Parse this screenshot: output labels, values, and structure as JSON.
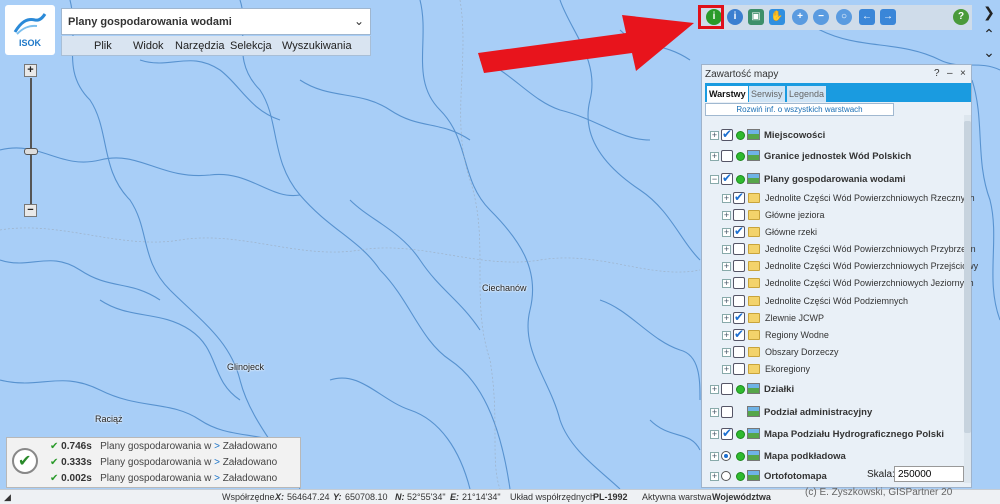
{
  "app": {
    "logo_text": "ISOK",
    "title": "Plany gospodarowania wodami"
  },
  "menu": [
    "Plik",
    "Widok",
    "Narzędzia",
    "Selekcja",
    "Wyszukiwania"
  ],
  "map": {
    "towns": [
      "Ciechanów",
      "Glinojeck",
      "Raciąż"
    ]
  },
  "toolbar": {
    "icons": [
      "info-green-icon",
      "info-blue-icon",
      "select-area-icon",
      "pan-hand-icon",
      "zoom-in-icon",
      "zoom-out-icon",
      "zoom-extent-icon",
      "history-back-icon",
      "history-forward-icon",
      "help-icon"
    ]
  },
  "panel": {
    "title": "Zawartość mapy",
    "tabs": [
      "Warstwy",
      "Serwisy",
      "Legenda"
    ],
    "expand_all": "Rozwiń inf. o wszystkich warstwach",
    "layers": [
      {
        "label": "Miejscowości",
        "level": 0,
        "checked": true,
        "dot": true,
        "icon": "image"
      },
      {
        "label": "Granice jednostek Wód Polskich",
        "level": 0,
        "checked": false,
        "dot": true,
        "icon": "image"
      },
      {
        "label": "Plany gospodarowania wodami",
        "level": 0,
        "checked": true,
        "dot": true,
        "icon": "image",
        "expanded": true
      },
      {
        "label": "Jednolite Części Wód Powierzchniowych Rzecznych",
        "level": 1,
        "checked": true,
        "icon": "folder"
      },
      {
        "label": "Główne jeziora",
        "level": 1,
        "checked": false,
        "icon": "folder"
      },
      {
        "label": "Główne rzeki",
        "level": 1,
        "checked": true,
        "icon": "folder"
      },
      {
        "label": "Jednolite Części Wód Powierzchniowych Przybrzeżn",
        "level": 1,
        "checked": false,
        "icon": "folder"
      },
      {
        "label": "Jednolite Części Wód Powierzchniowych Przejściowy",
        "level": 1,
        "checked": false,
        "icon": "folder"
      },
      {
        "label": "Jednolite Części Wód Powierzchniowych Jeziornych",
        "level": 1,
        "checked": false,
        "icon": "folder"
      },
      {
        "label": "Jednolite Części Wód Podziemnych",
        "level": 1,
        "checked": false,
        "icon": "folder"
      },
      {
        "label": "Zlewnie JCWP",
        "level": 1,
        "checked": true,
        "icon": "folder"
      },
      {
        "label": "Regiony Wodne",
        "level": 1,
        "checked": true,
        "icon": "folder"
      },
      {
        "label": "Obszary Dorzeczy",
        "level": 1,
        "checked": false,
        "icon": "folder"
      },
      {
        "label": "Ekoregiony",
        "level": 1,
        "checked": false,
        "icon": "folder"
      },
      {
        "label": "Działki",
        "level": 0,
        "checked": false,
        "dot": true,
        "icon": "image"
      },
      {
        "label": "Podział administracyjny",
        "level": 0,
        "checked": false,
        "icon": "image"
      },
      {
        "label": "Mapa Podziału Hydrograficznego Polski",
        "level": 0,
        "checked": true,
        "dot": true,
        "icon": "image"
      },
      {
        "label": "Mapa podkładowa",
        "level": 0,
        "radio": true,
        "checked": true,
        "dot": true,
        "icon": "image"
      },
      {
        "label": "Ortofotomapa",
        "level": 0,
        "radio": true,
        "checked": false,
        "dot": true,
        "icon": "image"
      }
    ],
    "scale_label": "Skala:",
    "scale_value": "250000"
  },
  "loading": [
    {
      "time": "0.746s",
      "text": "Plany gospodarowania w",
      "gt": ">",
      "status": "Załadowano"
    },
    {
      "time": "0.333s",
      "text": "Plany gospodarowania w",
      "gt": ">",
      "status": "Załadowano"
    },
    {
      "time": "0.002s",
      "text": "Plany gospodarowania w",
      "gt": ">",
      "status": "Załadowano"
    }
  ],
  "status": {
    "coords_label": "Współrzędne",
    "x_label": "X:",
    "x": "564647.24",
    "y_label": "Y:",
    "y": "650708.10",
    "n_label": "N:",
    "n": "52°55'34\"",
    "e_label": "E:",
    "e": "21°14'34\"",
    "crs_label": "Układ współrzędnych",
    "crs": "PL-1992",
    "active_label": "Aktywna warstwa",
    "active": "Województwa",
    "copyright": "(c) E. Zyszkowski, GISPartner 20"
  },
  "colors": {
    "map_bg": "#a8cef7",
    "river": "#4a88c9",
    "panel_tab": "#1a9be0",
    "highlight": "#e0101a"
  }
}
